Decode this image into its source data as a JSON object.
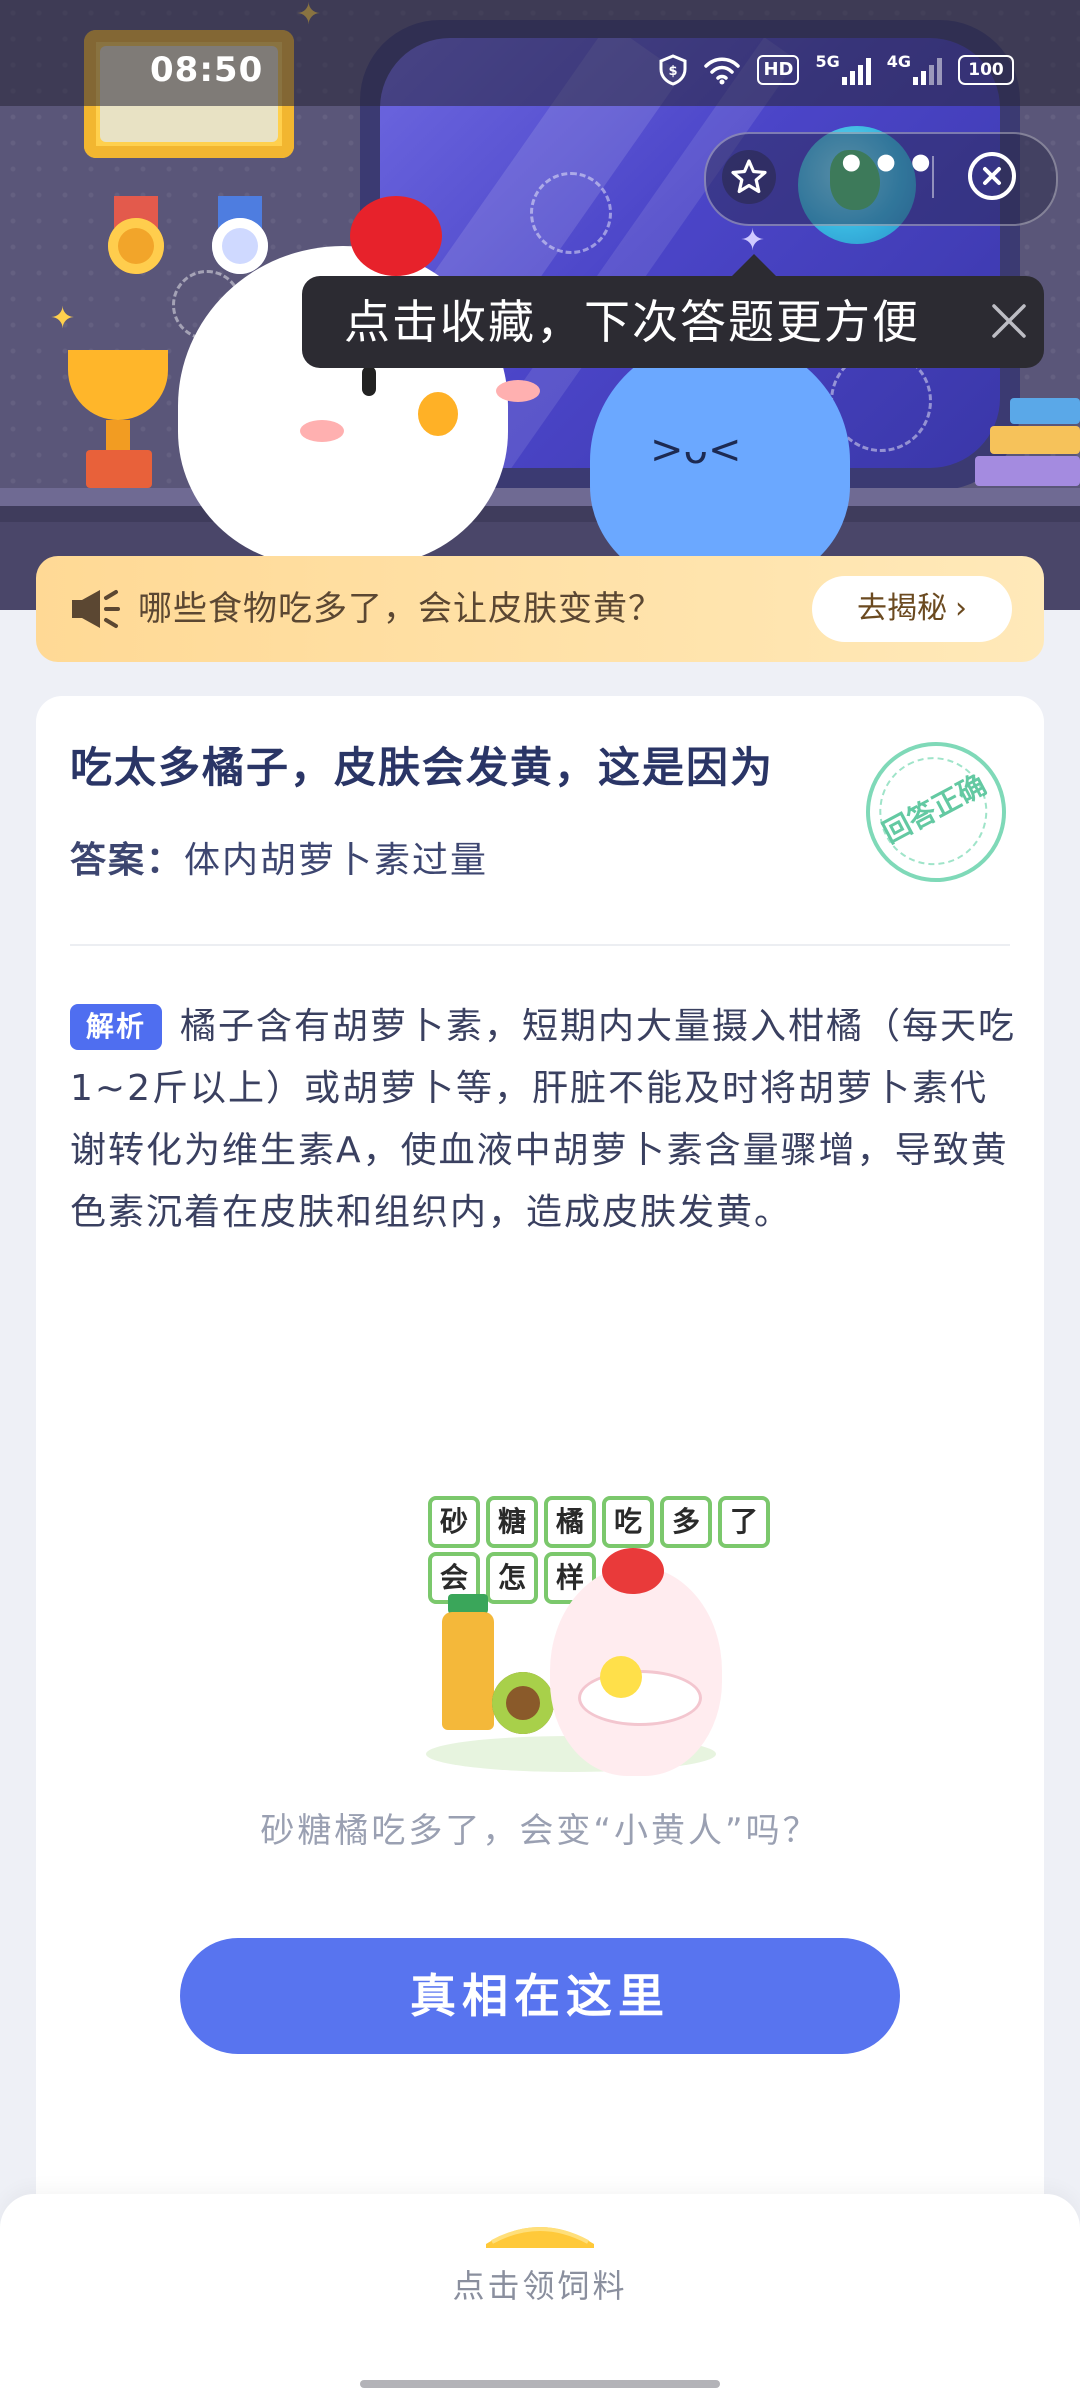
{
  "status_bar": {
    "time": "08:50",
    "icons": [
      "shield-icon",
      "wifi-icon",
      "hd-icon",
      "signal-5g-icon",
      "signal-4g-icon",
      "battery-icon"
    ],
    "hd_label": "HD",
    "net1_label": "5G",
    "net2_label": "4G",
    "battery_level": "100"
  },
  "capsule": {
    "star_icon": "star-icon",
    "more_icon": "more-dots-icon",
    "more_dots": "•••",
    "close_icon": "close-circle-icon"
  },
  "tooltip": {
    "text": "点击收藏，下次答题更方便",
    "close_icon": "close-icon"
  },
  "banner": {
    "icon": "megaphone-icon",
    "text": "哪些食物吃多了，会让皮肤变黄？",
    "button_label": "去揭秘",
    "chevron": "›"
  },
  "question": {
    "title": "吃太多橘子，皮肤会发黄，这是因为",
    "answer_label": "答案：",
    "answer_value": "体内胡萝卜素过量",
    "stamp_text": "回答正确"
  },
  "analysis": {
    "tag": "解析",
    "text": "橘子含有胡萝卜素，短期内大量摄入柑橘（每天吃1~2斤以上）或胡萝卜等，肝脏不能及时将胡萝卜素代谢转化为维生素A，使血液中胡萝卜素含量骤增，导致黄色素沉着在皮肤和组织内，造成皮肤发黄。"
  },
  "promo": {
    "tiles_row1": [
      "砂",
      "糖",
      "橘",
      "吃",
      "多",
      "了"
    ],
    "tiles_row2": [
      "会",
      "怎",
      "样"
    ],
    "caption": "砂糖橘吃多了，会变“小黄人”吗？",
    "cta_label": "真相在这里"
  },
  "bottom_bar": {
    "feed_label": "点击领饲料"
  },
  "colors": {
    "accent": "#5874ef",
    "banner_bg": "#ffe3a8",
    "question_text": "#2a3566",
    "stamp": "#63c9a2",
    "tag_bg": "#4f6ef0"
  }
}
